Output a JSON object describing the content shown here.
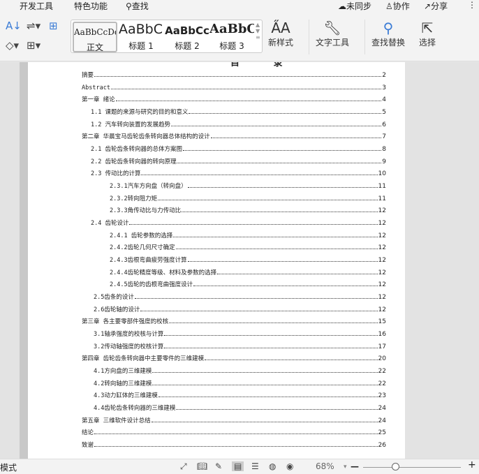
{
  "menu": {
    "dev_tools": "开发工具",
    "special": "特色功能",
    "search": "查找",
    "unsynced": "未同步",
    "collab": "协作",
    "share": "分享"
  },
  "ribbon": {
    "styles": [
      {
        "sample": "AaBbCcDd",
        "label": "正文"
      },
      {
        "sample": "AaBbC(",
        "label": "标题 1"
      },
      {
        "sample": "AaBbCc",
        "label": "标题 2"
      },
      {
        "sample": "AaBbC(",
        "label": "标题 3"
      }
    ],
    "new_style": "新样式",
    "text_tools": "文字工具",
    "find_replace": "查找替换",
    "select": "选择"
  },
  "document": {
    "title": "目 录",
    "toc": [
      {
        "text": "摘要",
        "page": "2",
        "level": 0
      },
      {
        "text": "Abstract",
        "page": "3",
        "level": 0
      },
      {
        "text": "第一章 绪论",
        "page": "4",
        "level": 0
      },
      {
        "text": "1.1 课题的来源与研究的目的和意义 ",
        "page": "5",
        "level": 1
      },
      {
        "text": "1.2 汽车转向装置的发展趋势",
        "page": "6",
        "level": 1
      },
      {
        "text": "第二章 华晨宝马齿轮齿条转向器总体结构的设计",
        "page": "7",
        "level": 0
      },
      {
        "text": "2.1 齿轮齿条转向器的总体方案图",
        "page": "8",
        "level": 1
      },
      {
        "text": "2.2 齿轮齿条转向器的转向原理",
        "page": "9",
        "level": 1
      },
      {
        "text": "2.3 传动比的计算",
        "page": "10",
        "level": 1
      },
      {
        "text": "2.3.1汽车方向盘（转向盘）",
        "page": "11",
        "level": 2
      },
      {
        "text": "2.3.2转向阻力矩",
        "page": "11",
        "level": 2
      },
      {
        "text": "2.3.3角传动比与力传动比",
        "page": "12",
        "level": 2
      },
      {
        "text": "2.4 齿轮设计",
        "page": "12",
        "level": 1
      },
      {
        "text": "2.4.1 齿轮参数的选择",
        "page": "12",
        "level": 2
      },
      {
        "text": "2.4.2齿轮几何尺寸确定",
        "page": "12",
        "level": 2
      },
      {
        "text": "2.4.3齿根弯曲疲劳强度计算",
        "page": "12",
        "level": 2
      },
      {
        "text": "2.4.4齿轮精度等级、材料及参数的选择",
        "page": "12",
        "level": 2
      },
      {
        "text": "2.4.5齿轮的齿根弯曲强度设计",
        "page": "12",
        "level": 2
      },
      {
        "text": "2.5齿条的设计",
        "page": "12",
        "level": 3
      },
      {
        "text": "2.6齿轮轴的设计",
        "page": "12",
        "level": 3
      },
      {
        "text": "第三章 各主要零部件强度的校核",
        "page": "15",
        "level": 0
      },
      {
        "text": "3.1轴承强度的校核与计算",
        "page": "16",
        "level": 3
      },
      {
        "text": "3.2传动轴强度的校核计算",
        "page": "17",
        "level": 3
      },
      {
        "text": "第四章 齿轮齿条转向器中主要零件的三维建模",
        "page": "20",
        "level": 0
      },
      {
        "text": "4.1方向盘的三维建模",
        "page": "22",
        "level": 3
      },
      {
        "text": "4.2转向轴的三维建模",
        "page": "22",
        "level": 3
      },
      {
        "text": "4.3动力缸体的三维建模",
        "page": "23",
        "level": 3
      },
      {
        "text": "4.4齿轮齿条转向器的三维建模",
        "page": "24",
        "level": 3
      },
      {
        "text": "第五章 三维软件设计总结",
        "page": "24",
        "level": 0
      },
      {
        "text": "结论",
        "page": "25",
        "level": 0
      },
      {
        "text": "致谢",
        "page": "26",
        "level": 0
      }
    ]
  },
  "status": {
    "mode": "模式",
    "zoom": "68%"
  }
}
